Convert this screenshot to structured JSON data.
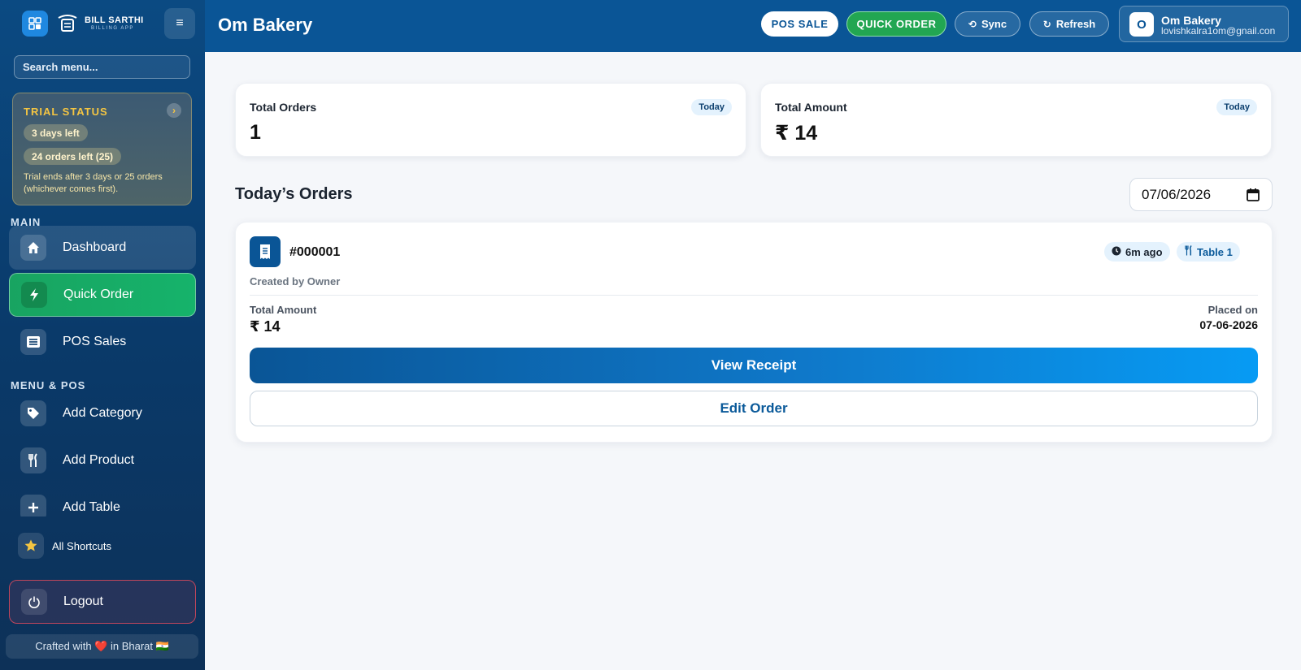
{
  "brand": {
    "name": "BILL SARTHI",
    "subtitle": "BILLING APP"
  },
  "sidebar": {
    "search_placeholder": "Search menu...",
    "trial": {
      "title": "TRIAL STATUS",
      "days_left": "3 days left",
      "orders_left": "24 orders left (25)",
      "note": "Trial ends after 3 days or 25 orders (whichever comes first)."
    },
    "sections": [
      {
        "label": "MAIN",
        "items": [
          {
            "label": "Dashboard",
            "icon": "home-icon"
          },
          {
            "label": "Quick Order",
            "icon": "bolt-icon"
          },
          {
            "label": "POS Sales",
            "icon": "list-icon"
          }
        ]
      },
      {
        "label": "MENU & POS",
        "items": [
          {
            "label": "Add Category",
            "icon": "tag-icon"
          },
          {
            "label": "Add Product",
            "icon": "utensils-icon"
          },
          {
            "label": "Add Table",
            "icon": "plus-icon"
          }
        ]
      }
    ],
    "shortcuts_label": "All Shortcuts",
    "logout_label": "Logout",
    "crafted": "Crafted with ❤️ in Bharat 🇮🇳"
  },
  "header": {
    "title": "Om Bakery",
    "buttons": {
      "pos_sale": "POS SALE",
      "quick_order": "QUICK ORDER",
      "sync": "Sync",
      "refresh": "Refresh"
    },
    "user": {
      "initial": "O",
      "name": "Om Bakery",
      "email": "lovishkalra1om@gnail.con"
    }
  },
  "stats": [
    {
      "label": "Total Orders",
      "value": "1",
      "badge": "Today"
    },
    {
      "label": "Total Amount",
      "value": "₹ 14",
      "badge": "Today"
    }
  ],
  "orders": {
    "title": "Today’s Orders",
    "date": "07/06/2026",
    "list": [
      {
        "id": "#000001",
        "created_by": "Created by Owner",
        "ago": "6m ago",
        "table": "Table 1",
        "total_label": "Total Amount",
        "total_value": "₹ 14",
        "placed_label": "Placed on",
        "placed_value": "07-06-2026",
        "view_label": "View Receipt",
        "edit_label": "Edit Order"
      }
    ]
  },
  "colors": {
    "primary": "#0a5596",
    "success": "#22a652",
    "trial_accent": "#f4c542",
    "logout_border": "#c0465c"
  }
}
